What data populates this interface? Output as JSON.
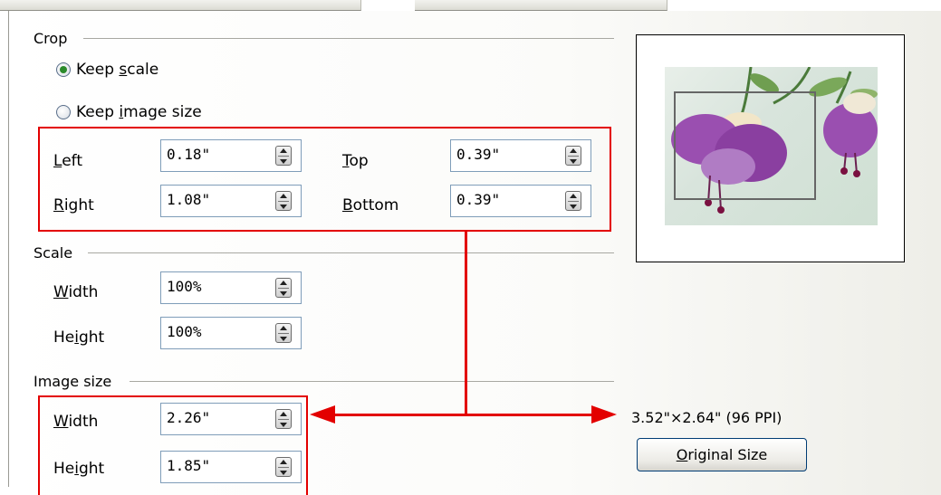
{
  "crop": {
    "section_label": "Crop",
    "keep_scale": {
      "prefix": "Keep ",
      "accel": "s",
      "suffix": "cale",
      "selected": true
    },
    "keep_image_size": {
      "prefix": "Keep ",
      "accel": "i",
      "suffix": "mage size",
      "selected": false
    },
    "left": {
      "accel": "L",
      "rest": "eft",
      "value": "0.18\""
    },
    "right": {
      "accel": "R",
      "rest": "ight",
      "value": "1.08\""
    },
    "top": {
      "accel": "T",
      "rest": "op",
      "value": "0.39\""
    },
    "bottom": {
      "accel": "B",
      "rest": "ottom",
      "value": "0.39\""
    }
  },
  "scale": {
    "section_label": "Scale",
    "width": {
      "accel": "W",
      "rest": "idth",
      "value": "100%"
    },
    "height": {
      "pre": "He",
      "accel": "i",
      "rest": "ght",
      "value": "100%"
    }
  },
  "image_size": {
    "section_label": "Image size",
    "width": {
      "accel": "W",
      "rest": "idth",
      "value": "2.26\""
    },
    "height": {
      "pre": "He",
      "accel": "i",
      "rest": "ght",
      "value": "1.85\""
    }
  },
  "original_info": "3.52\"×2.64\" (96 PPI)",
  "original_size_button": {
    "accel": "O",
    "rest": "riginal Size"
  },
  "colors": {
    "annotation_red": "#e30000",
    "flower_purple": "#8a3fa0"
  }
}
